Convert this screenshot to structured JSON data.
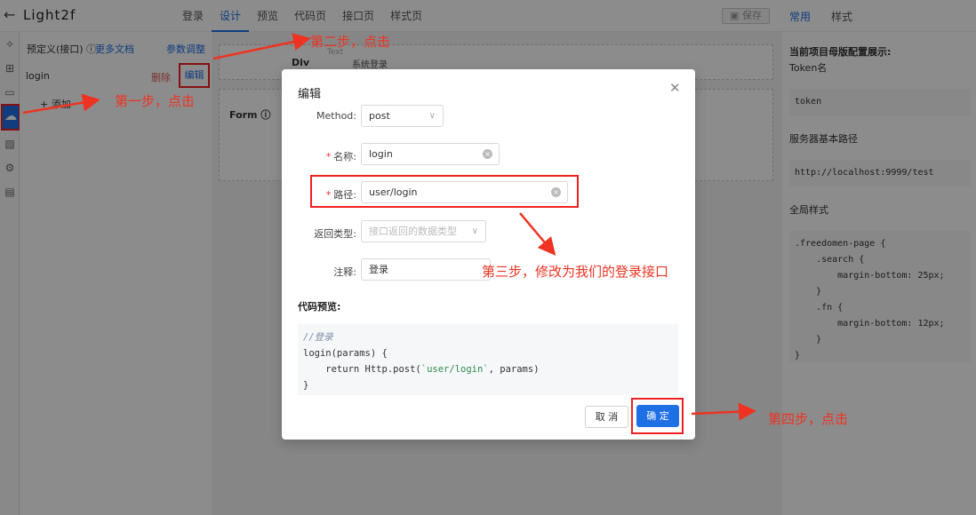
{
  "topbar": {
    "back_icon": "arrow-left-icon",
    "title": "Light2f",
    "tabs": [
      "登录",
      "设计",
      "预览",
      "代码页",
      "接口页",
      "样式页"
    ],
    "active_tab": "设计",
    "save_label": "保存",
    "right_tabs": [
      "常用",
      "样式"
    ]
  },
  "left_panel": {
    "header": "预定义(接口)",
    "more_docs": "更多文档",
    "param_adjust": "参数调整",
    "api_item": "login",
    "delete_label": "删除",
    "edit_label": "编辑",
    "add_label": "+ 添加"
  },
  "canvas": {
    "div_label": "Div",
    "form_label": "Form",
    "text_placeholder": "Text",
    "system_login": "系统登录"
  },
  "right_panel": {
    "project_config": "当前项目母版配置展示:",
    "token_name_label": "Token名",
    "token_value": "token",
    "server_path_label": "服务器基本路径",
    "server_path_value": "http://localhost:9999/test",
    "global_style_label": "全局样式",
    "global_style_code": ".freedomen-page {\n    .search {\n        margin-bottom: 25px;\n    }\n    .fn {\n        margin-bottom: 12px;\n    }\n}"
  },
  "modal": {
    "title": "编辑",
    "method_label": "Method:",
    "method_value": "post",
    "name_label": "名称:",
    "name_value": "login",
    "path_label": "路径:",
    "path_value": "user/login",
    "return_type_label": "返回类型:",
    "return_type_placeholder": "接口返回的数据类型",
    "comment_label": "注释:",
    "comment_value": "登录",
    "code_preview_title": "代码预览:",
    "code_comment": "//登录",
    "code_line1": "login(params) {",
    "code_line2_pre": "    return Http.post(",
    "code_line2_str": "`user/login`",
    "code_line2_post": ", params)",
    "code_line3": "}",
    "cancel_label": "取 消",
    "ok_label": "确 定"
  },
  "annotations": {
    "step1": "第一步，点击",
    "step2": "第二步，点击",
    "step3": "第三步，修改为我们的登录接口",
    "step4": "第四步，点击"
  },
  "colors": {
    "primary": "#1f6fe5",
    "annotation_red": "#ee3322"
  }
}
